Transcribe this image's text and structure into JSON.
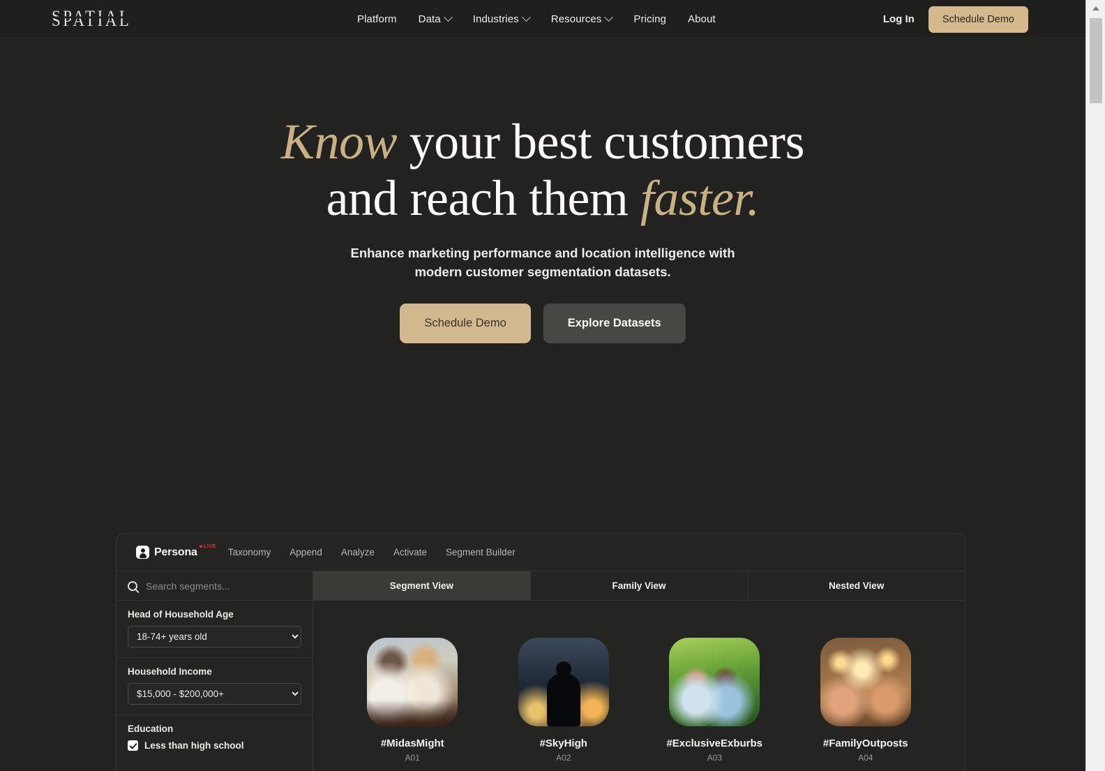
{
  "site": {
    "logo": "SPATIAL"
  },
  "nav": {
    "items": [
      {
        "label": "Platform",
        "has_caret": false
      },
      {
        "label": "Data",
        "has_caret": true
      },
      {
        "label": "Industries",
        "has_caret": true
      },
      {
        "label": "Resources",
        "has_caret": true
      },
      {
        "label": "Pricing",
        "has_caret": false
      },
      {
        "label": "About",
        "has_caret": false
      }
    ],
    "login_label": "Log In",
    "demo_label": "Schedule Demo"
  },
  "hero": {
    "headline_line1_accent": "Know",
    "headline_line1_rest": " your best customers",
    "headline_line2_rest": "and reach them ",
    "headline_line2_accent": "faster.",
    "subhead": "Enhance marketing performance and location intelligence with modern customer segmentation datasets.",
    "cta_primary": "Schedule Demo",
    "cta_secondary": "Explore Datasets"
  },
  "app": {
    "brand": "Persona",
    "live_badge": "LIVE",
    "tabs": [
      "Taxonomy",
      "Append",
      "Analyze",
      "Activate",
      "Segment Builder"
    ],
    "search_placeholder": "Search segments...",
    "filters": [
      {
        "label": "Head of Household Age",
        "type": "select",
        "value": "18-74+ years old",
        "options": [
          "18-74+ years old"
        ]
      },
      {
        "label": "Household Income",
        "type": "select",
        "value": "$15,000 - $200,000+",
        "options": [
          "$15,000 - $200,000+"
        ]
      },
      {
        "label": "Education",
        "type": "checkbox",
        "checkbox_label": "Less than high school",
        "checked": true
      }
    ],
    "view_tabs": [
      {
        "label": "Segment View",
        "active": true
      },
      {
        "label": "Family View",
        "active": false
      },
      {
        "label": "Nested View",
        "active": false
      }
    ],
    "segments": [
      {
        "name": "#MidasMight",
        "code": "A01",
        "art": "art-midas"
      },
      {
        "name": "#SkyHigh",
        "code": "A02",
        "art": "art-sky"
      },
      {
        "name": "#ExclusiveExburbs",
        "code": "A03",
        "art": "art-exburbs"
      },
      {
        "name": "#FamilyOutposts",
        "code": "A04",
        "art": "art-family"
      }
    ]
  },
  "colors": {
    "page_bg": "#222220",
    "nav_bg": "#1f1f1d",
    "accent_gold": "#c9b183",
    "button_gold": "#d4b98d",
    "live_red": "#e0322c",
    "panel_bg": "#242422",
    "panel_border": "#343431",
    "tab_active_bg": "#3a3a37"
  }
}
